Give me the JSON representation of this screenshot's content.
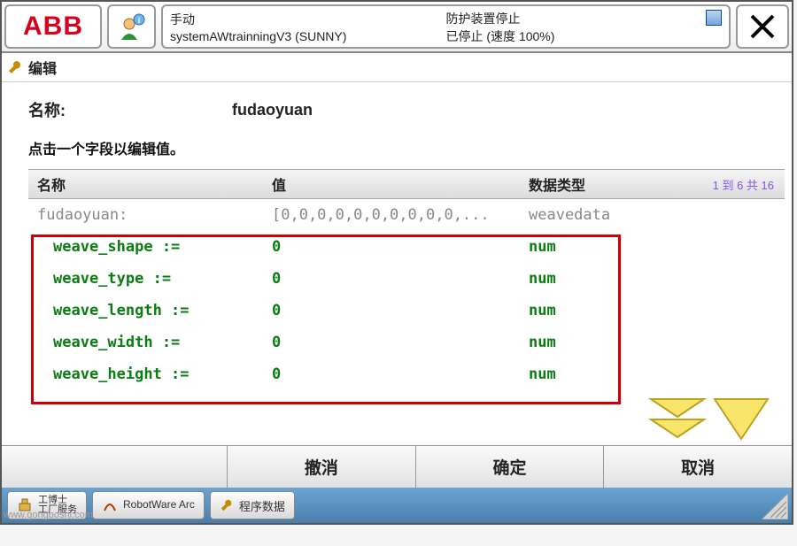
{
  "titlebar": {
    "logo": "ABB",
    "mode": "手动",
    "system": "systemAWtrainningV3 (SUNNY)",
    "guard": "防护装置停止",
    "stopped": "已停止 (速度 100%)"
  },
  "editlabel": "编辑",
  "field": {
    "label": "名称:",
    "value": "fudaoyuan"
  },
  "instruction": "点击一个字段以编辑值。",
  "headers": {
    "c1": "名称",
    "c2": "值",
    "c3": "数据类型",
    "range": "1 到 6 共 16"
  },
  "rows": {
    "top": {
      "name": "fudaoyuan:",
      "value": "[0,0,0,0,0,0,0,0,0,0,...",
      "type": "weavedata"
    },
    "r1": {
      "name": "weave_shape :=",
      "value": "0",
      "type": "num"
    },
    "r2": {
      "name": "weave_type :=",
      "value": "0",
      "type": "num"
    },
    "r3": {
      "name": "weave_length :=",
      "value": "0",
      "type": "num"
    },
    "r4": {
      "name": "weave_width :=",
      "value": "0",
      "type": "num"
    },
    "r5": {
      "name": "weave_height :=",
      "value": "0",
      "type": "num"
    }
  },
  "buttons": {
    "undo": "撤消",
    "ok": "确定",
    "cancel": "取消"
  },
  "taskbar": {
    "a_line1": "工博士",
    "a_line2": "工厂服务",
    "b": "RobotWare Arc",
    "c": "程序数据"
  },
  "watermark": "www.gongboshi.com"
}
